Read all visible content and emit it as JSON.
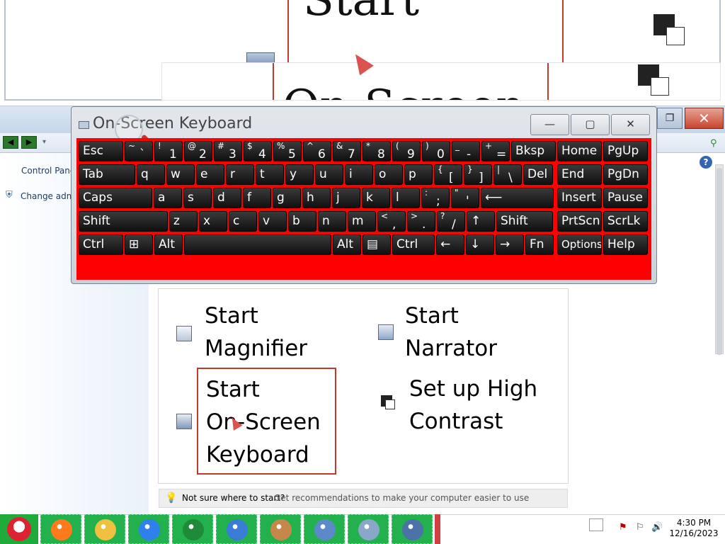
{
  "magnifier": {
    "text_top": "Start",
    "text_bottom": "On-Screen"
  },
  "control_panel": {
    "side_links": [
      "Control Panel Home",
      "Change administrative settings"
    ],
    "search_icon": "search-icon",
    "help_icon": "?"
  },
  "ease_panel": {
    "items": [
      {
        "line1": "Start",
        "line2": "Magnifier",
        "icon": "magnifier-icon"
      },
      {
        "line1": "Start",
        "line2": "Narrator",
        "icon": "narrator-icon"
      },
      {
        "line1": "Start",
        "line2": "On-Screen",
        "line3": "Keyboard",
        "icon": "keyboard-icon"
      },
      {
        "line1": "Set up High",
        "line2": "Contrast",
        "icon": "high-contrast-icon"
      }
    ],
    "tip": {
      "lead": "Not sure where to start?",
      "link": "Get recommendations to make your computer easier to use"
    }
  },
  "osk": {
    "title": "On-Screen Keyboard",
    "controls": {
      "minimize": "—",
      "maximize": "▢",
      "close": "✕"
    },
    "accent": "#ff0000",
    "rows": [
      [
        {
          "main": "Esc"
        },
        {
          "alt": "~",
          "main": "`"
        },
        {
          "alt": "!",
          "main": "1"
        },
        {
          "alt": "@",
          "main": "2"
        },
        {
          "alt": "#",
          "main": "3"
        },
        {
          "alt": "$",
          "main": "4"
        },
        {
          "alt": "%",
          "main": "5"
        },
        {
          "alt": "^",
          "main": "6"
        },
        {
          "alt": "&",
          "main": "7"
        },
        {
          "alt": "*",
          "main": "8"
        },
        {
          "alt": "(",
          "main": "9"
        },
        {
          "alt": ")",
          "main": "0"
        },
        {
          "alt": "_",
          "main": "-"
        },
        {
          "alt": "+",
          "main": "="
        },
        {
          "main": "Bksp"
        },
        {
          "main": "Home"
        },
        {
          "main": "PgUp"
        }
      ],
      [
        {
          "main": "Tab"
        },
        {
          "main": "q"
        },
        {
          "main": "w"
        },
        {
          "main": "e"
        },
        {
          "main": "r"
        },
        {
          "main": "t"
        },
        {
          "main": "y"
        },
        {
          "main": "u"
        },
        {
          "main": "i"
        },
        {
          "main": "o"
        },
        {
          "main": "p"
        },
        {
          "alt": "{",
          "main": "["
        },
        {
          "alt": "}",
          "main": "]"
        },
        {
          "alt": "|",
          "main": "\\"
        },
        {
          "main": "Del"
        },
        {
          "main": "End"
        },
        {
          "main": "PgDn"
        }
      ],
      [
        {
          "main": "Caps"
        },
        {
          "main": "a"
        },
        {
          "main": "s"
        },
        {
          "main": "d"
        },
        {
          "main": "f"
        },
        {
          "main": "g"
        },
        {
          "main": "h"
        },
        {
          "main": "j"
        },
        {
          "main": "k"
        },
        {
          "main": "l"
        },
        {
          "alt": ":",
          "main": ";"
        },
        {
          "alt": "\"",
          "main": "'"
        },
        {
          "main": "⟵"
        },
        {
          "main": "Insert"
        },
        {
          "main": "Pause"
        }
      ],
      [
        {
          "main": "Shift"
        },
        {
          "main": "z"
        },
        {
          "main": "x"
        },
        {
          "main": "c"
        },
        {
          "main": "v"
        },
        {
          "main": "b"
        },
        {
          "main": "n"
        },
        {
          "main": "m"
        },
        {
          "alt": "<",
          "main": ","
        },
        {
          "alt": ">",
          "main": "."
        },
        {
          "alt": "?",
          "main": "/"
        },
        {
          "main": "↑"
        },
        {
          "main": "Shift"
        },
        {
          "main": "PrtScn"
        },
        {
          "main": "ScrLk"
        }
      ],
      [
        {
          "main": "Ctrl"
        },
        {
          "main": "⊞"
        },
        {
          "main": "Alt"
        },
        {
          "main": ""
        },
        {
          "main": "Alt"
        },
        {
          "main": "▤"
        },
        {
          "main": "Ctrl"
        },
        {
          "main": "←"
        },
        {
          "main": "↓"
        },
        {
          "main": "→"
        },
        {
          "main": "Fn"
        },
        {
          "main": "Options"
        },
        {
          "main": "Help"
        }
      ]
    ]
  },
  "taskbar": {
    "items": [
      "firefox-icon",
      "file-explorer-icon",
      "chrome-icon",
      "tree-icon",
      "messenger-icon",
      "paint-icon",
      "control-panel-icon",
      "keyboard-app-icon",
      "ease-of-access-icon"
    ],
    "time": "4:30 PM",
    "date": "12/16/2023"
  }
}
